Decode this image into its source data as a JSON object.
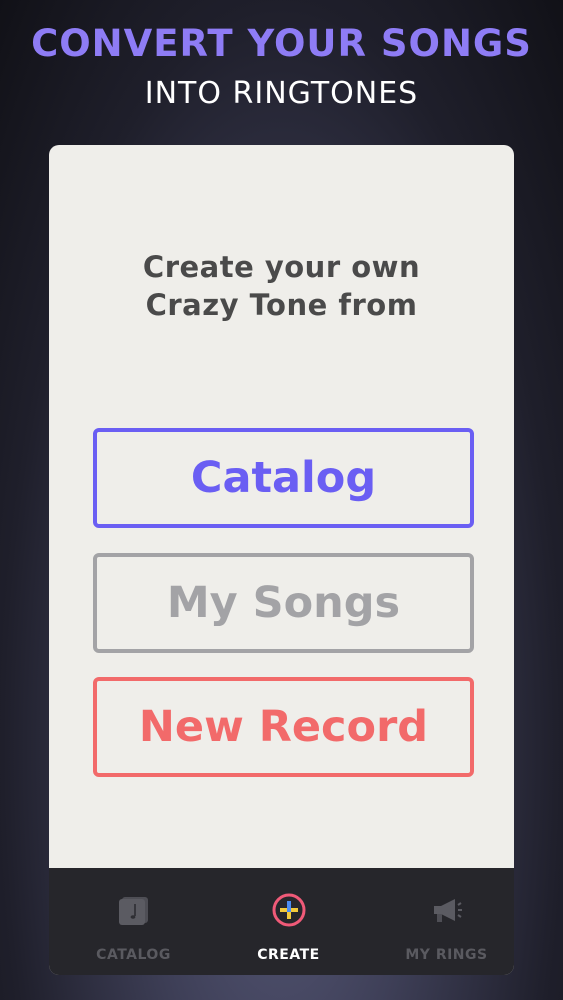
{
  "promo": {
    "headline": "CONVERT YOUR SONGS",
    "subheadline": "INTO RINGTONES"
  },
  "screen": {
    "prompt_line1": "Create your own",
    "prompt_line2": "Crazy Tone from",
    "options": {
      "catalog": "Catalog",
      "my_songs": "My Songs",
      "new_record": "New Record"
    }
  },
  "tabbar": {
    "tabs": [
      {
        "label": "CATALOG",
        "icon": "music-note-icon",
        "active": false
      },
      {
        "label": "CREATE",
        "icon": "plus-circle-icon",
        "active": true
      },
      {
        "label": "MY RINGS",
        "icon": "megaphone-icon",
        "active": false
      }
    ]
  },
  "colors": {
    "headline": "#8e7cf5",
    "catalog": "#6a5ef3",
    "my_songs": "#a3a3a6",
    "new_record": "#f26a6a",
    "card_bg": "#efeeea",
    "tabbar_bg": "#26262b"
  }
}
